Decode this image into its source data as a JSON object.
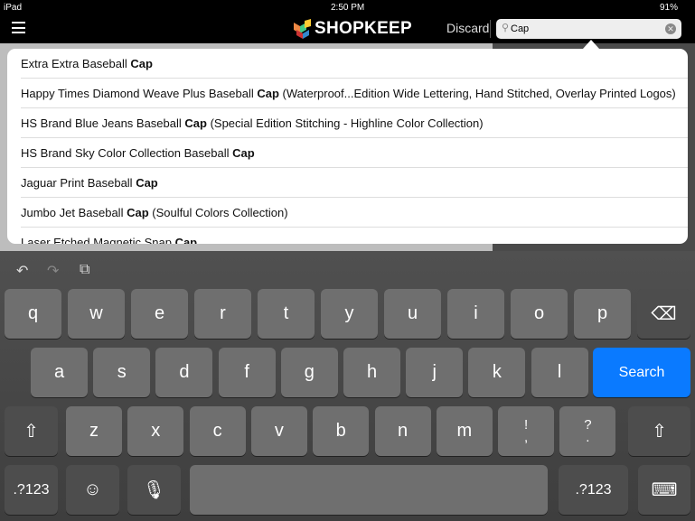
{
  "status": {
    "device": "iPad",
    "time": "2:50 PM",
    "battery": "91%"
  },
  "nav": {
    "brand": "SHOPKEEP",
    "discard": "Discard",
    "search_value": "Cap",
    "menu_icon": "hamburger-icon"
  },
  "results": [
    {
      "pre": "Extra Extra Baseball ",
      "match": "Cap",
      "post": ""
    },
    {
      "pre": "Happy Times Diamond Weave Plus Baseball ",
      "match": "Cap",
      "post": " (Waterproof...Edition Wide Lettering, Hand Stitched, Overlay Printed Logos)"
    },
    {
      "pre": "HS Brand Blue Jeans Baseball ",
      "match": "Cap",
      "post": " (Special Edition Stitching - Highline Color Collection)"
    },
    {
      "pre": "HS Brand Sky Color Collection Baseball ",
      "match": "Cap",
      "post": ""
    },
    {
      "pre": "Jaguar Print Baseball ",
      "match": "Cap",
      "post": ""
    },
    {
      "pre": "Jumbo Jet Baseball ",
      "match": "Cap",
      "post": " (Soulful Colors Collection)"
    },
    {
      "pre": "Laser Etched Magnetic Snap ",
      "match": "Cap",
      "post": ""
    }
  ],
  "keyboard": {
    "row1": [
      "q",
      "w",
      "e",
      "r",
      "t",
      "y",
      "u",
      "i",
      "o",
      "p"
    ],
    "row2": [
      "a",
      "s",
      "d",
      "f",
      "g",
      "h",
      "j",
      "k",
      "l"
    ],
    "row3": [
      "z",
      "x",
      "c",
      "v",
      "b",
      "n",
      "m",
      "!\n,",
      "?\n."
    ],
    "search": "Search",
    "numbers": ".?123",
    "accent": "#0a7aff"
  }
}
